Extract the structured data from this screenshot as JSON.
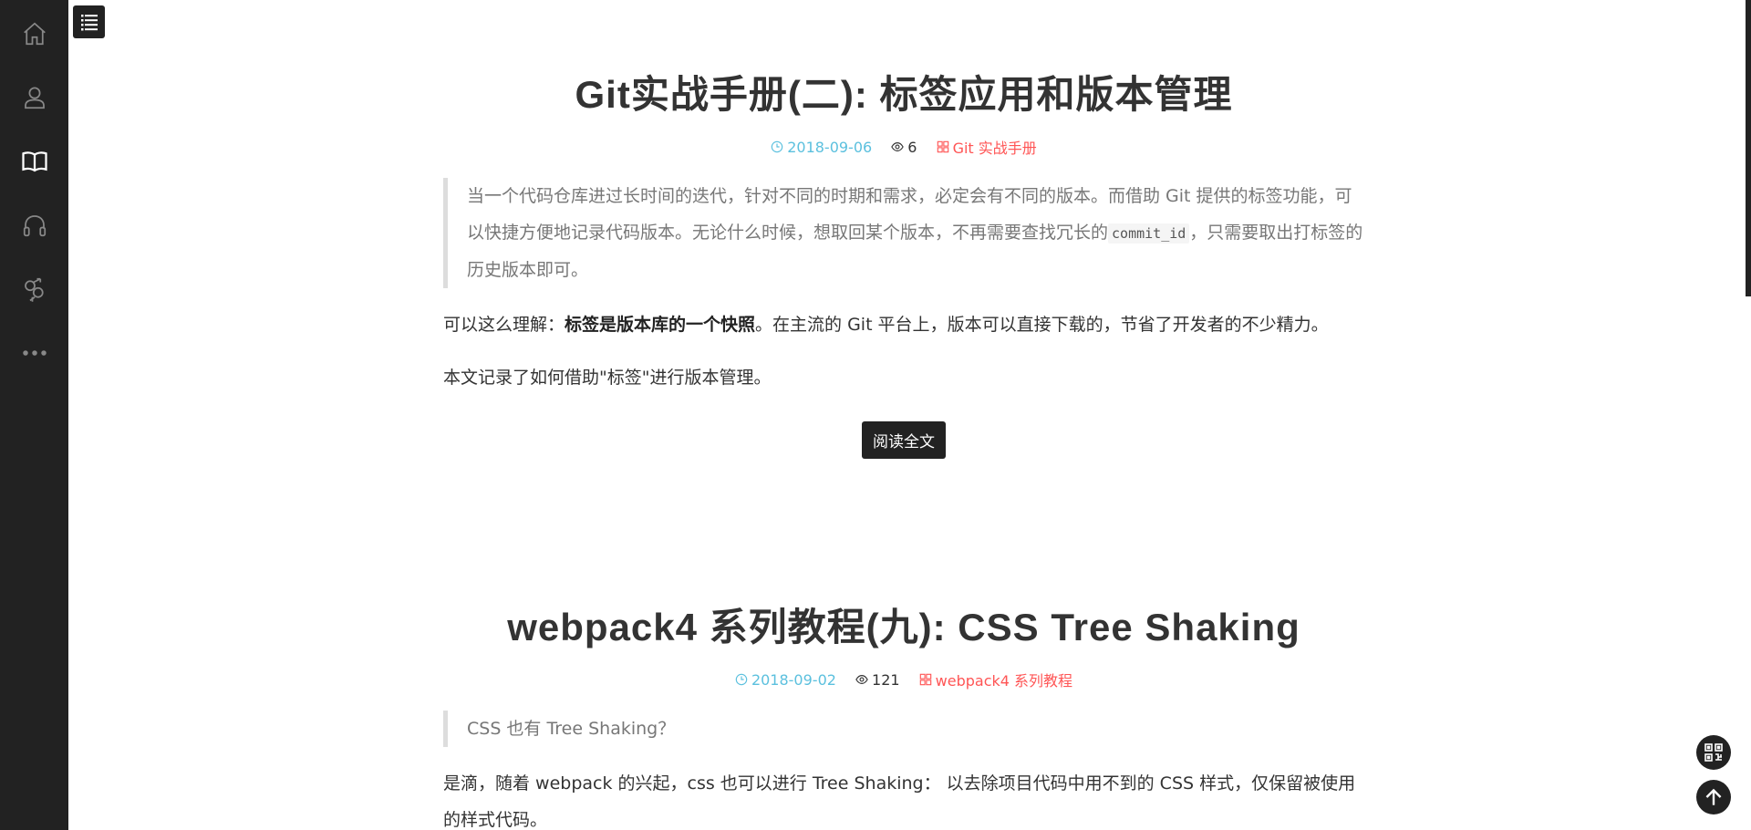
{
  "sidebar": {
    "items": [
      {
        "icon": "home-icon"
      },
      {
        "icon": "user-icon"
      },
      {
        "icon": "book-icon"
      },
      {
        "icon": "headphones-icon"
      },
      {
        "icon": "gender-icon"
      },
      {
        "icon": "more-icon"
      }
    ]
  },
  "posts": [
    {
      "title": "Git实战手册(二): 标签应用和版本管理",
      "date": "2018-09-06",
      "views": "6",
      "category": "Git 实战手册",
      "quote_before_code": "当一个代码仓库进过长时间的迭代，针对不同的时期和需求，必定会有不同的版本。而借助 Git 提供的标签功能，可以快捷方便地记录代码版本。无论什么时候，想取回某个版本，不再需要查找冗长的",
      "quote_code": "commit_id",
      "quote_after_code": "，只需要取出打标签的历史版本即可。",
      "para1_before": "可以这么理解：",
      "para1_bold": "标签是版本库的一个快照",
      "para1_after": "。在主流的 Git 平台上，版本可以直接下载的，节省了开发者的不少精力。",
      "para2": "本文记录了如何借助\"标签\"进行版本管理。",
      "read_more": "阅读全文"
    },
    {
      "title": "webpack4 系列教程(九): CSS Tree Shaking",
      "date": "2018-09-02",
      "views": "121",
      "category": "webpack4 系列教程",
      "quote": "CSS 也有 Tree Shaking？",
      "para1": "是滴，随着 webpack 的兴起，css 也可以进行 Tree Shaking： 以去除项目代码中用不到的 CSS 样式，仅保留被使用的样式代码。"
    }
  ],
  "colors": {
    "sidebar_bg": "#222222",
    "date": "#5bc0de",
    "category": "#ff5555"
  }
}
